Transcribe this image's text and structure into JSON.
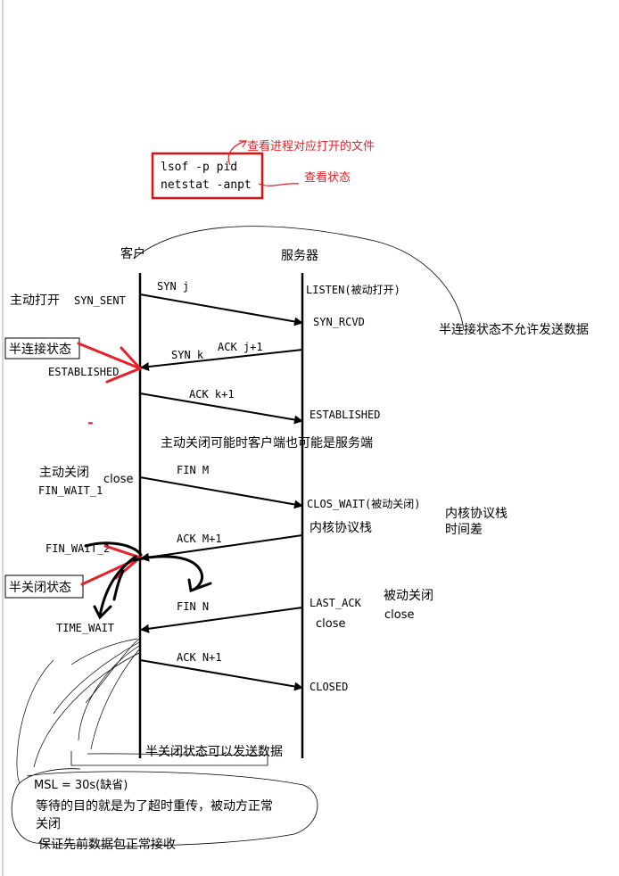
{
  "commands": {
    "lines": [
      "lsof -p pid",
      "netstat -anpt"
    ],
    "note_files": "查看进程对应打开的文件",
    "note_status": "查看状态"
  },
  "columns": {
    "client": "客户",
    "server": "服务器"
  },
  "states": {
    "syn_sent": "SYN_SENT",
    "listen": "LISTEN(被动打开)",
    "syn_rcvd": "SYN_RCVD",
    "established_client": "ESTABLISHED",
    "established_server": "ESTABLISHED",
    "fin_wait_1": "FIN_WAIT_1",
    "clos_wait": "CLOS_WAIT(被动关闭)",
    "fin_wait_2": "FIN_WAIT_2",
    "last_ack": "LAST_ACK",
    "time_wait": "TIME_WAIT",
    "closed": "CLOSED"
  },
  "messages": {
    "syn_j": "SYN j",
    "syn_k": "SYN k",
    "ack_j1": "ACK j+1",
    "ack_k1": "ACK k+1",
    "fin_m": "FIN M",
    "ack_m1": "ACK M+1",
    "fin_n": "FIN N",
    "ack_n1": "ACK N+1"
  },
  "annotations": {
    "active_open": "主动打开",
    "half_conn_state": "半连接状态",
    "half_conn_no_send": "半连接状态不允许发送数据",
    "dash": "-",
    "active_close_either": "主动关闭可能时客户端也可能是服务端",
    "active_close": "主动关闭",
    "close_client": "close",
    "kernel_stack_1": "内核协议栈",
    "kernel_stack_2": "内核协议栈",
    "time_diff": "时间差",
    "half_close_state": "半关闭状态",
    "passive_close": "被动关闭",
    "close_server_1": "close",
    "close_server_2": "close",
    "half_close_can_send": "半关闭状态可以发送数据",
    "msl": "MSL = 30s(缺省)",
    "wait_purpose_1": "等待的目的就是为了超时重传，被动方正常",
    "wait_purpose_2": "关闭",
    "ensure_packets": "保证先前数据包正常接收"
  },
  "colors": {
    "ink": "#000000",
    "red": "#e8202a",
    "box_red": "#e01010"
  }
}
